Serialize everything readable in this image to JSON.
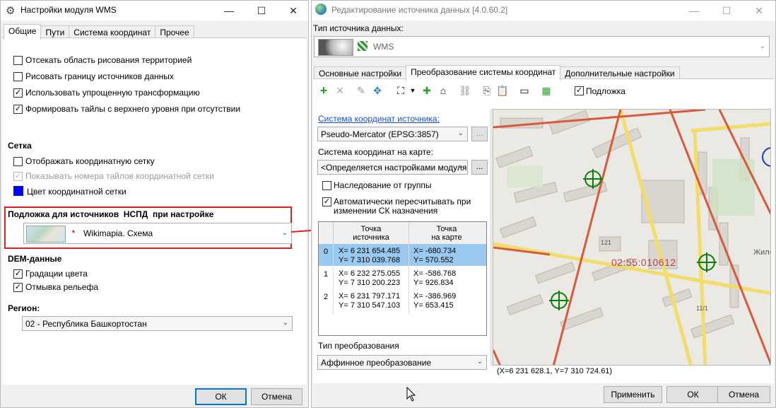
{
  "left_window": {
    "title": "Настройки модуля WMS",
    "tabs": [
      "Общие",
      "Пути",
      "Система координат",
      "Прочее"
    ],
    "checkboxes": [
      {
        "label": "Отсекать область рисования территорией",
        "checked": false
      },
      {
        "label": "Рисовать границу источников данных",
        "checked": false
      },
      {
        "label": "Использовать упрощенную трансформацию",
        "checked": true
      },
      {
        "label": "Формировать тайлы с верхнего уровня при отсутствии",
        "checked": true
      }
    ],
    "grid": {
      "header": "Сетка",
      "show_grid": "Отображать координатную сетку",
      "show_numbers": "Показывать номера тайлов координатной сетки",
      "color_label": "Цвет координатной сетки",
      "color": "#0000ff"
    },
    "basemap": {
      "header_pre": "Подложка для источников",
      "header_mid": "НСПД",
      "header_post": "при настройке",
      "value": "Wikimapia. Схема"
    },
    "dem": {
      "header": "DEM-данные",
      "items": [
        "Градации цвета",
        "Отмывка рельефа"
      ]
    },
    "region": {
      "header": "Регион:",
      "value": "02 - Республика Башкортостан"
    },
    "ok": "ОК",
    "cancel": "Отмена"
  },
  "right_window": {
    "title": "Редактирование источника данных [4.0.60.2]",
    "source_type_label": "Тип источника данных:",
    "source_type_value": "WMS",
    "tabs": [
      "Основные настройки",
      "Преобразование системы координат",
      "Дополнительные настройки"
    ],
    "basemap_checkbox": "Подложка",
    "src_crs_label": "Система координат источника:",
    "src_crs_value": "Pseudo-Mercator (EPSG:3857)",
    "map_crs_label": "Система координат на карте:",
    "map_crs_value": "<Определяется настройками модуля",
    "browse": "...",
    "inherit_label": "Наследование от группы",
    "auto_label_1": "Автоматически пересчитывать при",
    "auto_label_2": "изменении СК назначения",
    "table": {
      "col1_l1": "Точка",
      "col1_l2": "источника",
      "col2_l1": "Точка",
      "col2_l2": "на карте",
      "rows": [
        {
          "n": "0",
          "sx": "X= 6 231 654.485",
          "sy": "Y= 7 310 039.768",
          "mx": "X= -680.734",
          "my": "Y= 570.552"
        },
        {
          "n": "1",
          "sx": "X= 6 232 275.055",
          "sy": "Y= 7 310 200.223",
          "mx": "X= -586.768",
          "my": "Y= 926.834"
        },
        {
          "n": "2",
          "sx": "X= 6 231 797.171",
          "sy": "Y= 7 310 547.103",
          "mx": "X= -386.969",
          "my": "Y= 653.415"
        }
      ]
    },
    "transform_label": "Тип преобразования",
    "transform_value": "Аффинное преобразование",
    "map_time": "02:55:010612",
    "map_labels": [
      "121",
      "11/1",
      "Жило"
    ],
    "coords_status": "(X=6 231 628.1, Y=7 310 724.61)",
    "apply": "Применить",
    "ok": "ОК",
    "cancel": "Отмена"
  },
  "colors": {
    "accent": "#0078d7",
    "highlight": "#e02020",
    "selected_row": "#99c9ef",
    "marker": "#0a7d0a"
  }
}
